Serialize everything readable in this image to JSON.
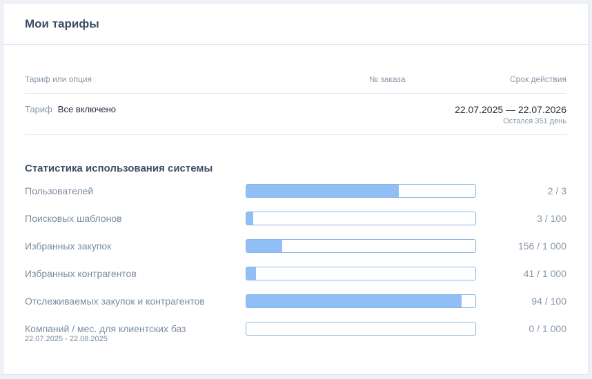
{
  "header": {
    "title": "Мои тарифы"
  },
  "tariffs": {
    "columns": {
      "name": "Тариф или опция",
      "order": "№ заказа",
      "term": "Срок действия"
    },
    "row": {
      "type": "Тариф",
      "name": "Все включено",
      "order": "",
      "period": "22.07.2025 — 22.07.2026",
      "remaining": "Остался 351 день"
    }
  },
  "stats": {
    "title": "Статистика использования системы",
    "items": [
      {
        "label": "Пользователей",
        "value": "2 / 3",
        "used": 2,
        "limit": 3
      },
      {
        "label": "Поисковых шаблонов",
        "value": "3 / 100",
        "used": 3,
        "limit": 100
      },
      {
        "label": "Избранных закупок",
        "value": "156 / 1 000",
        "used": 156,
        "limit": 1000
      },
      {
        "label": "Избранных контрагентов",
        "value": "41 / 1 000",
        "used": 41,
        "limit": 1000
      },
      {
        "label": "Отслеживаемых закупок и контрагентов",
        "value": "94 / 100",
        "used": 94,
        "limit": 100
      },
      {
        "label": "Компаний / мес. для клиентских баз",
        "sub": "22.07.2025 - 22.08.2025",
        "value": "0 / 1 000",
        "used": 0,
        "limit": 1000
      }
    ]
  },
  "colors": {
    "bar_fill": "#90bff5",
    "bar_border": "#8ab5e4",
    "title": "#3d4f66",
    "muted": "#8797ab"
  }
}
